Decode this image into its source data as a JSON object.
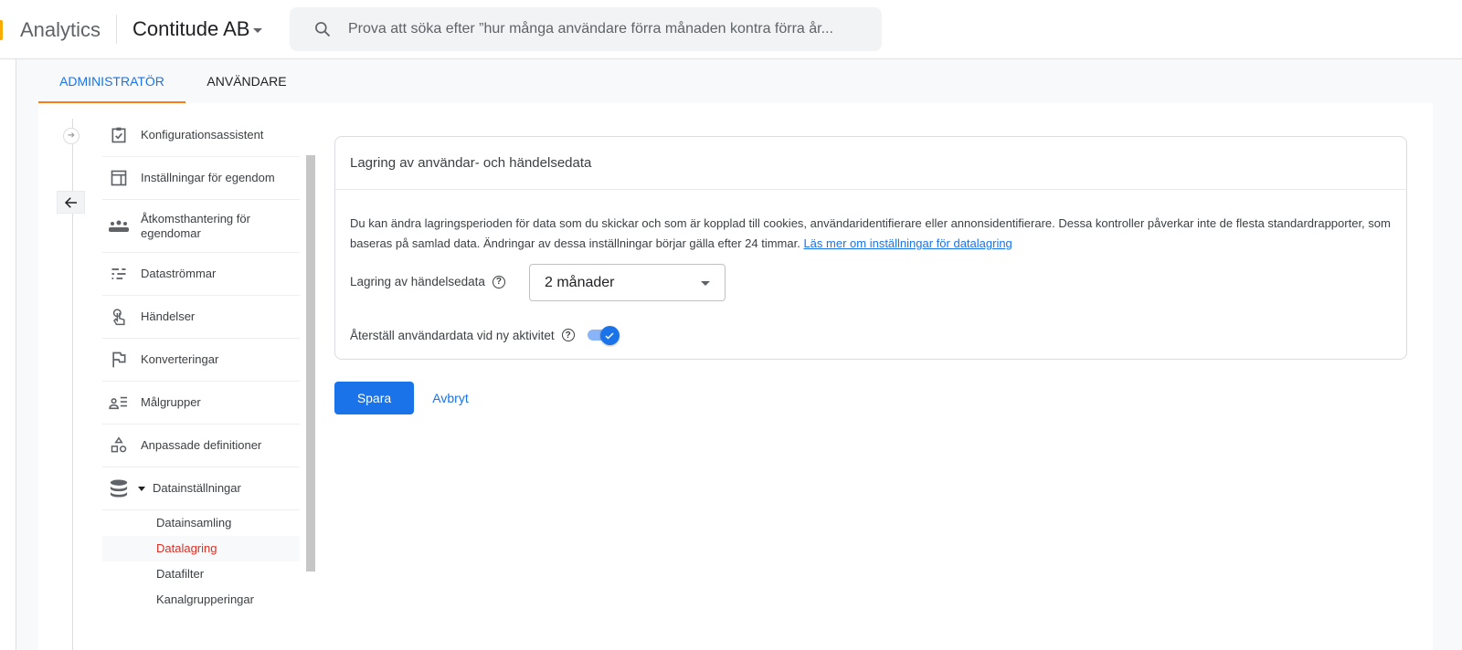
{
  "header": {
    "app_name": "Analytics",
    "account": "Contitude AB",
    "search_placeholder": "Prova att söka efter ”hur många användare förra månaden kontra förra år..."
  },
  "tabs": [
    {
      "label": "ADMINISTRATÖR",
      "active": true
    },
    {
      "label": "ANVÄNDARE",
      "active": false
    }
  ],
  "nav": {
    "items": [
      {
        "label": "Konfigurationsassistent",
        "icon": "checklist-icon"
      },
      {
        "label": "Inställningar för egendom",
        "icon": "layout-icon"
      },
      {
        "label": "Åtkomsthantering för egendomar",
        "icon": "people-icon"
      },
      {
        "label": "Dataströmmar",
        "icon": "streams-icon"
      },
      {
        "label": "Händelser",
        "icon": "touch-icon"
      },
      {
        "label": "Konverteringar",
        "icon": "flag-icon"
      },
      {
        "label": "Målgrupper",
        "icon": "audience-icon"
      },
      {
        "label": "Anpassade definitioner",
        "icon": "shapes-icon"
      },
      {
        "label": "Datainställningar",
        "icon": "database-icon"
      }
    ],
    "subitems": [
      {
        "label": "Datainsamling"
      },
      {
        "label": "Datalagring",
        "active": true
      },
      {
        "label": "Datafilter"
      },
      {
        "label": "Kanalgrupperingar"
      }
    ]
  },
  "card": {
    "title": "Lagring av användar- och händelsedata",
    "description": "Du kan ändra lagringsperioden för data som du skickar och som är kopplad till cookies, användaridentifierare eller annonsidentifierare. Dessa kontroller påverkar inte de flesta standardrapporter, som baseras på samlad data. Ändringar av dessa inställningar börjar gälla efter 24 timmar.",
    "link": "Läs mer om inställningar för datalagring",
    "retention_label": "Lagring av händelsedata",
    "retention_value": "2 månader",
    "reset_label": "Återställ användardata vid ny aktivitet",
    "reset_enabled": true
  },
  "actions": {
    "save": "Spara",
    "cancel": "Avbryt"
  },
  "colors": {
    "primary": "#1a73e8",
    "active_nav": "#d93025",
    "tab_indicator": "#fa7b17"
  }
}
